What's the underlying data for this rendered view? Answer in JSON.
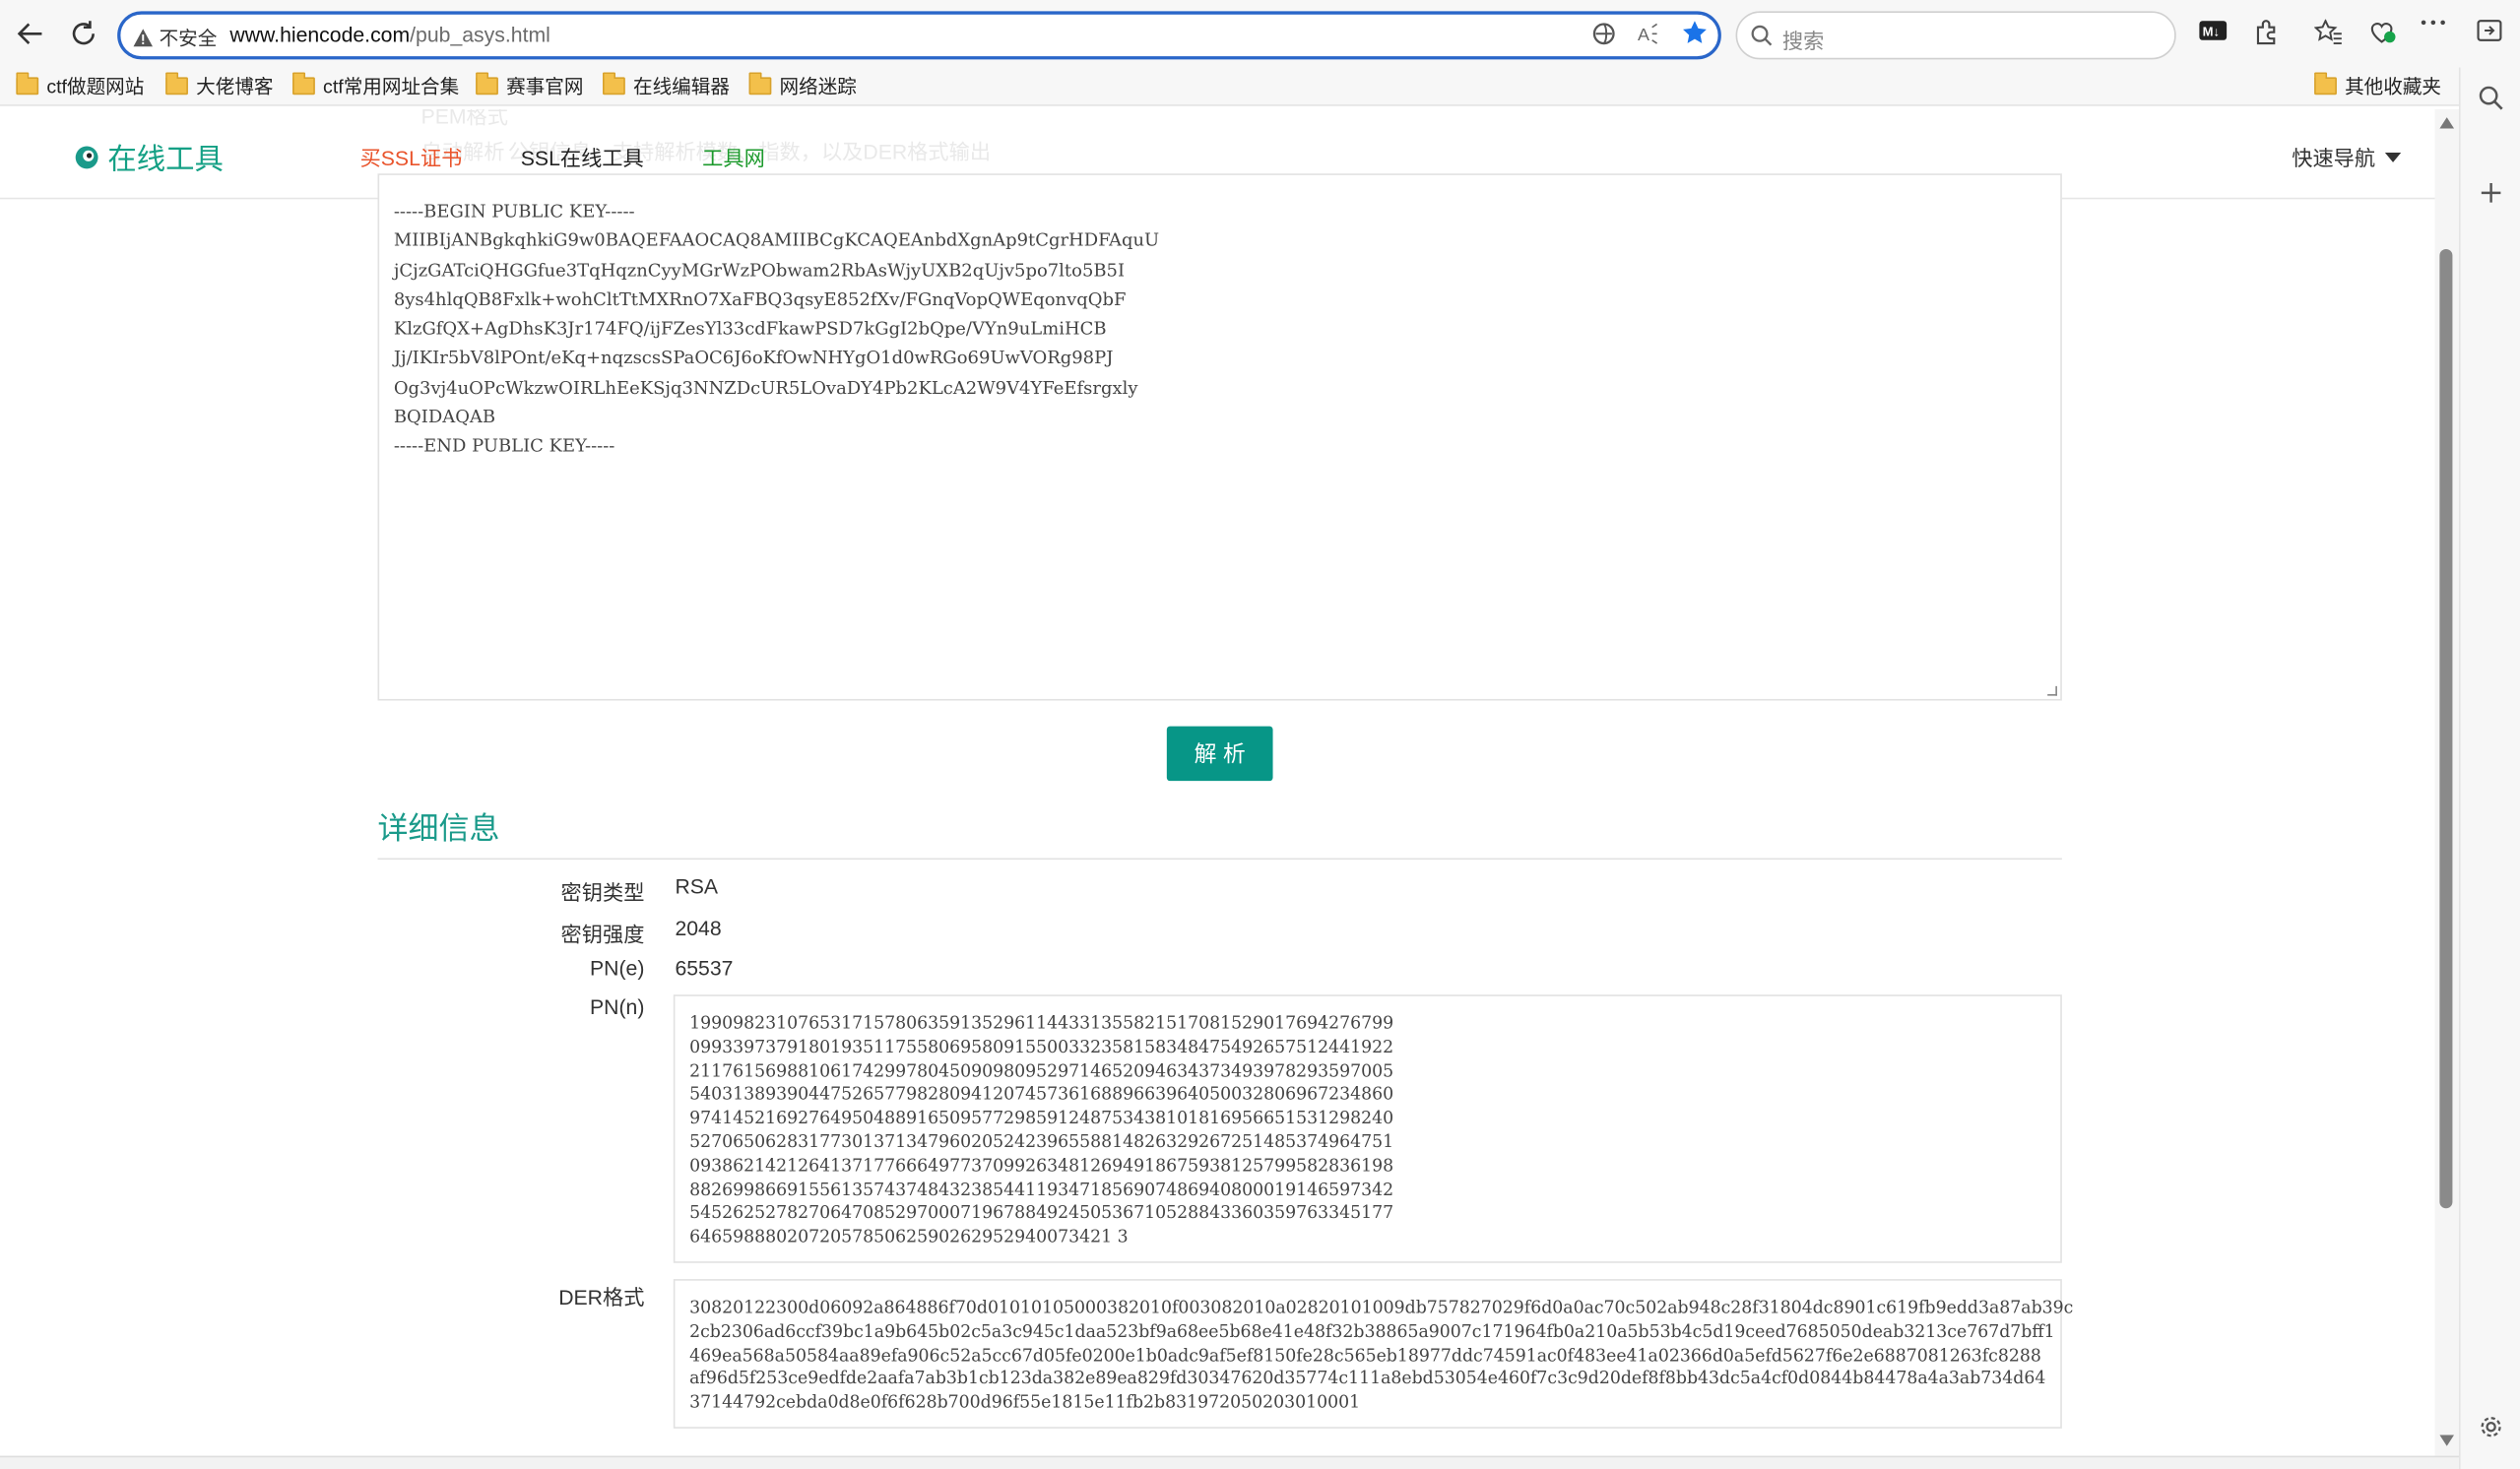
{
  "browser": {
    "security_label": "不安全",
    "url_domain": "www.hiencode.com",
    "url_path": "/pub_asys.html",
    "search_placeholder": "搜索",
    "bookmarks": [
      "ctf做题网站",
      "大佬博客",
      "ctf常用网址合集",
      "赛事官网",
      "在线编辑器",
      "网络迷踪"
    ],
    "other_bookmarks": "其他收藏夹"
  },
  "site": {
    "logo": "在线工具",
    "nav": [
      "买SSL证书",
      "SSL在线工具",
      "工具网"
    ],
    "quick_nav": "快速导航"
  },
  "input": {
    "pem_lines": [
      "-----BEGIN PUBLIC KEY-----",
      "MIIBIjANBgkqhkiG9w0BAQEFAAOCAQ8AMIIBCgKCAQEAnbdXgnAp9tCgrHDFAquU",
      "jCjzGATciQHGGfue3TqHqznCyyMGrWzPObwam2RbAsWjyUXB2qUjv5po7lto5B5I",
      "8ys4hlqQB8Fxlk+wohCltTtMXRnO7XaFBQ3qsyE852fXv/FGnqVopQWEqonvqQbF",
      "KlzGfQX+AgDhsK3Jr174FQ/ijFZesYl33cdFkawPSD7kGgI2bQpe/VYn9uLmiHCB",
      "Jj/IKIr5bV8lPOnt/eKq+nqzscsSPaOC6J6oKfOwNHYgO1d0wRGo69UwVORg98PJ",
      "Og3vj4uOPcWkzwOIRLhEeKSjq3NNZDcUR5LOvaDY4Pb2KLcA2W9V4YFeEfsrgxly",
      "BQIDAQAB",
      "-----END PUBLIC KEY-----"
    ],
    "parse_button": "解 析"
  },
  "details": {
    "title": "详细信息",
    "key_type_label": "密钥类型",
    "key_type": "RSA",
    "key_strength_label": "密钥强度",
    "key_strength": "2048",
    "e_label": "PN(e)",
    "e_value": "65537",
    "n_label": "PN(n)",
    "n_lines": [
      "19909823107653171578063591352961144331355821517081529017694276799",
      "09933973791801935117558069580915500332358158348475492657512441922",
      "21176156988106174299780450909809529714652094634373493978293597005",
      "54031389390447526577982809412074573616889663964050032806967234860",
      "97414521692764950488916509577298591248753438101816956651531298240",
      "52706506283177301371347960205242396558814826329267251485374964751",
      "09386214212641371776664977370992634812694918675938125799582836198",
      "88269986691556135743748432385441193471856907486940800019146597342",
      "54526252782706470852970007196788492450536710528843360359763345177",
      "646598880207205785062590262952940073421 3"
    ],
    "der_label": "DER格式",
    "der_lines": [
      "30820122300d06092a864886f70d01010105000382010f003082010a02820101009db757827029f6d0a0ac70c502ab948c28f31804dc8901c619fb9edd3a87ab39c",
      "2cb2306ad6ccf39bc1a9b645b02c5a3c945c1daa523bf9a68ee5b68e41e48f32b38865a9007c171964fb0a210a5b53b4c5d19ceed7685050deab3213ce767d7bff1",
      "469ea568a50584aa89efa906c52a5cc67d05fe0200e1b0adc9af5ef8150fe28c565eb18977ddc74591ac0f483ee41a02366d0a5efd5627f6e2e6887081263fc8288",
      "af96d5f253ce9edfde2aafa7ab3b1cb123da382e89ea829fd30347620d35774c111a8ebd53054e460f7c3c9d20def8f8bb43dc5a4cf0d0844b84478a4a3ab734d64",
      "37144792cebda0d8e0f6f628b700d96f55e1815e11fb2b831972050203010001"
    ]
  },
  "ghost_text": [
    "PEM格式",
    "自动解析",
    "公钥信息，支持解析模数、指数，以及DER格式输出"
  ],
  "colors": {
    "accent": "#079687",
    "title": "#1a9a8a",
    "nav_ssl": "#e9542c",
    "nav_tool": "#1c9a2c"
  }
}
